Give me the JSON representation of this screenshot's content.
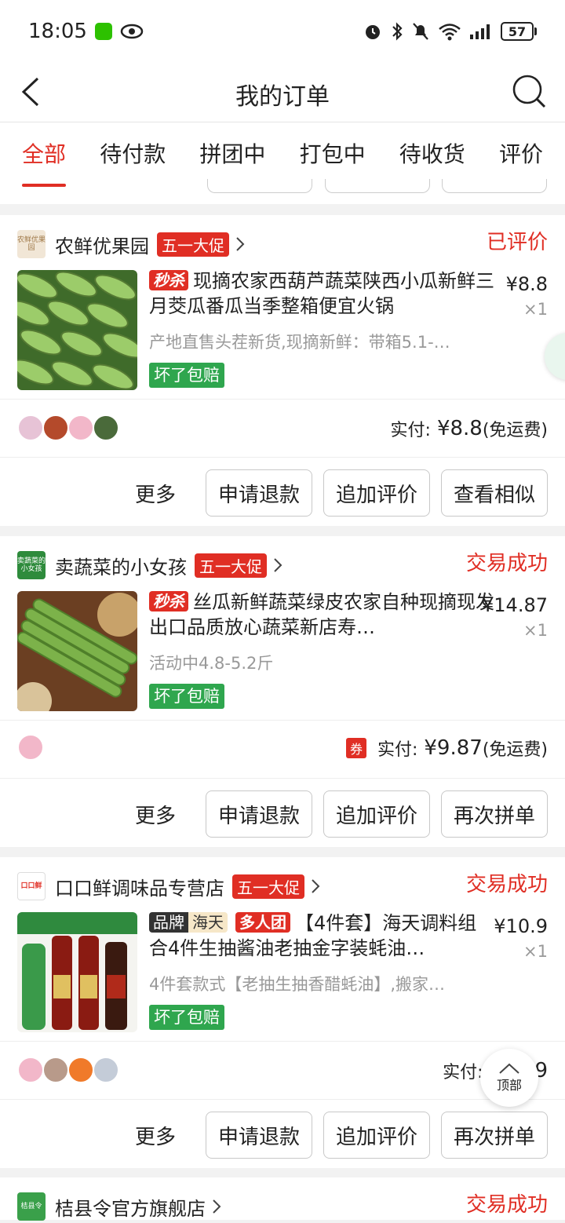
{
  "status_bar": {
    "time": "18:05",
    "battery": "57"
  },
  "header": {
    "title": "我的订单"
  },
  "tabs": [
    "全部",
    "待付款",
    "拼团中",
    "打包中",
    "待收货",
    "评价"
  ],
  "labels": {
    "more": "更多",
    "paid_prefix": "实付:",
    "coupon": "券",
    "back_to_top": "顶部",
    "promo": "五一大促",
    "guarantee": "坏了包赔",
    "miaosha": "秒杀",
    "brand": "品牌",
    "multi_group": "多人团"
  },
  "orders": [
    {
      "store_logo_text": "农鲜优果园",
      "store_name": "农鲜优果园",
      "status": "已评价",
      "title": "现摘农家西葫芦蔬菜陕西小瓜新鲜三月茭瓜番瓜当季整箱便宜火锅",
      "spec": "产地直售头茬新货,现摘新鲜：带箱5.1-…",
      "price": "¥8.8",
      "qty": "×1",
      "paid": "¥8.8",
      "shipping": "(免运费)",
      "buttons": [
        "申请退款",
        "追加评价",
        "查看相似"
      ]
    },
    {
      "store_logo_text": "卖蔬菜的小女孩",
      "store_name": "卖蔬菜的小女孩",
      "status": "交易成功",
      "title": "丝瓜新鲜蔬菜绿皮农家自种现摘现发出口品质放心蔬菜新店寿…",
      "spec": "活动中4.8-5.2斤",
      "price": "¥14.87",
      "qty": "×1",
      "paid": "¥9.87",
      "shipping": "(免运费)",
      "buttons": [
        "申请退款",
        "追加评价",
        "再次拼单"
      ]
    },
    {
      "store_logo_text": "口口鲜",
      "store_name": "口口鲜调味品专营店",
      "status": "交易成功",
      "brand_name": "海天",
      "title": "【4件套】海天调料组合4件生抽酱油老抽金字装蚝油…",
      "spec": "4件套款式【老抽生抽香醋蚝油】,搬家…",
      "price": "¥10.9",
      "qty": "×1",
      "paid": "¥10.9",
      "buttons": [
        "申请退款",
        "追加评价",
        "再次拼单"
      ]
    },
    {
      "store_logo_text": "桔县令",
      "store_name": "桔县令官方旗舰店",
      "status": "交易成功"
    }
  ]
}
